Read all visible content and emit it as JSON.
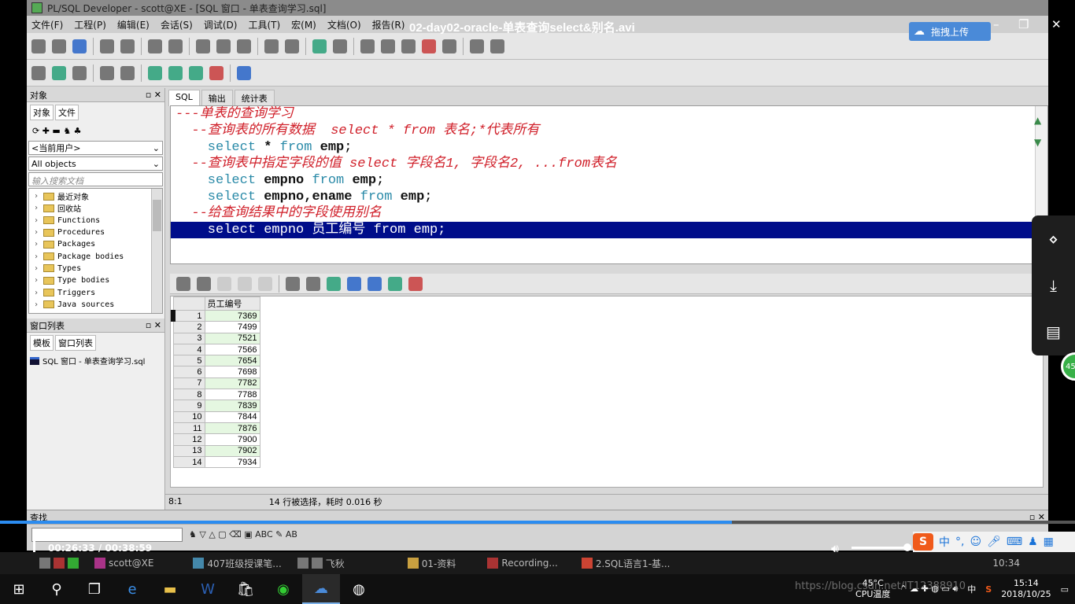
{
  "app": {
    "window_title": "PL/SQL Developer - scott@XE - [SQL 窗口 - 单表查询学习.sql]",
    "menu": [
      "文件(F)",
      "工程(P)",
      "编辑(E)",
      "会话(S)",
      "调试(D)",
      "工具(T)",
      "宏(M)",
      "文档(O)",
      "报告(R)"
    ]
  },
  "left_panel": {
    "objects_title": "对象",
    "tabs": [
      "对象",
      "文件"
    ],
    "user_combo": "<当前用户>",
    "objects_combo": "All objects",
    "search_placeholder": "输入搜索文档",
    "tree": [
      "最近对象",
      "回收站",
      "Functions",
      "Procedures",
      "Packages",
      "Package bodies",
      "Types",
      "Type bodies",
      "Triggers",
      "Java sources"
    ],
    "window_list_title": "窗口列表",
    "window_list_tabs": [
      "模板",
      "窗口列表"
    ],
    "window_list_item": "SQL 窗口 - 单表查询学习.sql"
  },
  "editor": {
    "tabs": [
      "SQL",
      "输出",
      "统计表"
    ],
    "lines": [
      {
        "type": "comment",
        "text": "---单表的查询学习"
      },
      {
        "type": "comment",
        "text": "  --查询表的所有数据  select * from 表名;*代表所有"
      },
      {
        "type": "code",
        "kw1": "    select",
        "id1": " * ",
        "kw2": "from",
        "id2": " emp",
        "rest": ";"
      },
      {
        "type": "comment",
        "text": "  --查询表中指定字段的值 select 字段名1, 字段名2, ...from表名"
      },
      {
        "type": "code",
        "kw1": "    select",
        "id1": " empno ",
        "kw2": "from",
        "id2": " emp",
        "rest": ";"
      },
      {
        "type": "code",
        "kw1": "    select",
        "id1": " empno,ename ",
        "kw2": "from",
        "id2": " emp",
        "rest": ";"
      },
      {
        "type": "comment",
        "text": "  --给查询结果中的字段使用别名"
      },
      {
        "type": "selected",
        "text": "    select empno 员工编号 from emp;"
      }
    ]
  },
  "result": {
    "column": "员工编号",
    "rows": [
      {
        "n": "1",
        "v": "7369"
      },
      {
        "n": "2",
        "v": "7499"
      },
      {
        "n": "3",
        "v": "7521"
      },
      {
        "n": "4",
        "v": "7566"
      },
      {
        "n": "5",
        "v": "7654"
      },
      {
        "n": "6",
        "v": "7698"
      },
      {
        "n": "7",
        "v": "7782"
      },
      {
        "n": "8",
        "v": "7788"
      },
      {
        "n": "9",
        "v": "7839"
      },
      {
        "n": "10",
        "v": "7844"
      },
      {
        "n": "11",
        "v": "7876"
      },
      {
        "n": "12",
        "v": "7900"
      },
      {
        "n": "13",
        "v": "7902"
      },
      {
        "n": "14",
        "v": "7934"
      }
    ]
  },
  "status": {
    "position": "8:1",
    "message": "14 行被选择，耗时 0.016 秒"
  },
  "find": {
    "title": "查找"
  },
  "player": {
    "video_title": "02-day02-oracle-单表查询select&别名.avi",
    "upload_label": "拖拽上传",
    "time": "00:26:33 / 00:38:59",
    "progress": 0.681,
    "volume": 0.9
  },
  "inner_taskbar": [
    "scott@XE",
    "407班级授课笔...",
    "飞秋",
    "01-资料",
    "Recording...",
    "2.SQL语言1-基..."
  ],
  "inner_clock": "10:34",
  "taskbar": {
    "temperature": "45°C",
    "temp_label": "CPU温度",
    "ime": "中",
    "time": "15:14",
    "date": "2018/10/25",
    "badge": "45"
  },
  "watermark": "https://blog.csdn.net/IT12388910"
}
